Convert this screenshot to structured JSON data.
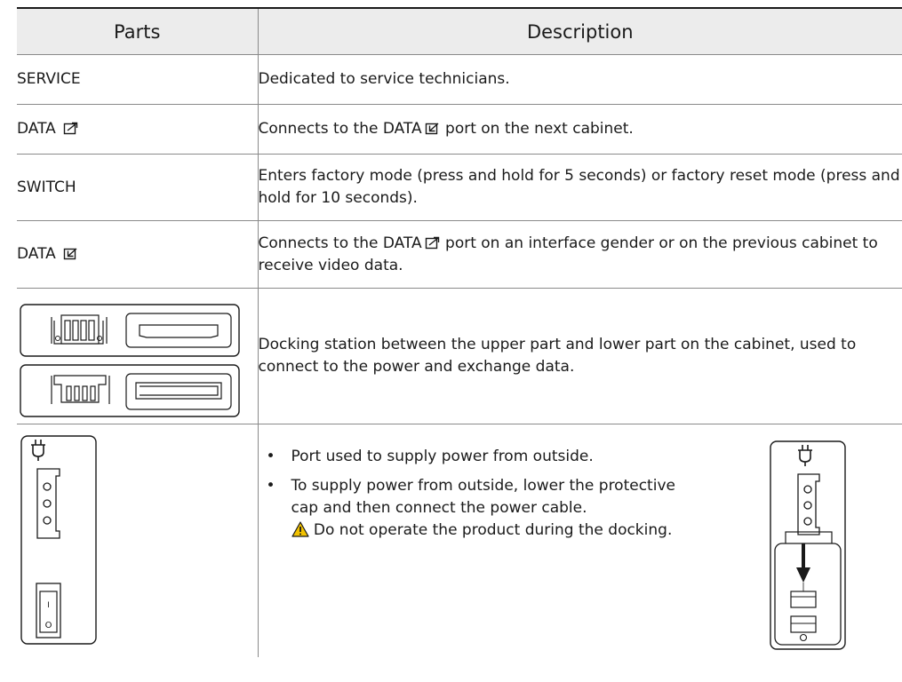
{
  "table": {
    "headers": {
      "parts": "Parts",
      "description": "Description"
    },
    "rows": {
      "service": {
        "part": "SERVICE",
        "desc": "Dedicated to service technicians."
      },
      "data_out": {
        "part": "DATA",
        "desc_before": "Connects to the ",
        "desc_strong": "DATA",
        "desc_after": " port on the next cabinet."
      },
      "switch": {
        "part": "SWITCH",
        "desc": "Enters factory mode (press and hold for 5 seconds) or factory reset mode (press and hold for 10 seconds)."
      },
      "data_in": {
        "part": "DATA",
        "desc_before": "Connects to the ",
        "desc_strong": "DATA",
        "desc_after": " port on an interface gender or on the previous cabinet to receive video data."
      },
      "docking": {
        "desc": "Docking station between the upper part and lower part on the cabinet, used to connect to the power and exchange data."
      },
      "power": {
        "bullet_1": "Port used to supply power from outside.",
        "bullet_2": "To supply power from outside, lower the protective cap and then connect the power cable.",
        "warning": "Do not operate the product during the docking.",
        "switch_on_glyph": "I",
        "switch_off_glyph": "O"
      }
    }
  },
  "icons": {
    "data_out": "port-out-icon",
    "data_in": "port-in-icon",
    "warning": "warning-triangle-icon",
    "plug": "power-plug-icon"
  },
  "colors": {
    "header_bg": "#ececec",
    "rule": "#8a8a8a",
    "warning_fill": "#f2c200"
  }
}
